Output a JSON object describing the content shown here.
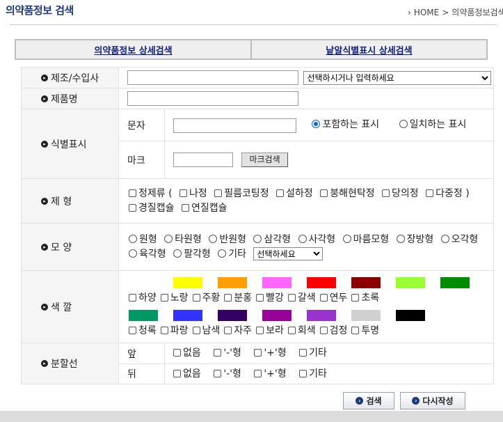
{
  "header": {
    "title": "의약품정보 검색",
    "breadcrumb": [
      "HOME",
      "의약품정보검색"
    ],
    "separator": ">"
  },
  "tabs": [
    {
      "label": "의약품정보 상세검색"
    },
    {
      "label": "낱알식별표시 상세검색"
    }
  ],
  "form": {
    "manufacturer": {
      "label": "제조/수입사",
      "input_value": "",
      "select_value": "선택하시거나 입력하세요"
    },
    "product": {
      "label": "제품명",
      "input_value": ""
    },
    "identifier": {
      "label": "식별표시",
      "text_label": "문자",
      "text_value": "",
      "radio_contains": "포함하는 표시",
      "radio_exact": "일치하는 표시",
      "mark_label": "마크",
      "mark_value": "",
      "mark_button": "마크검색"
    },
    "form_type": {
      "label": "제 형",
      "paren_open": "(",
      "paren_close": ")",
      "options": [
        "정제류",
        "나정",
        "필름코팅정",
        "설하정",
        "붕해현탁정",
        "당의정",
        "다중정",
        "경질캡슐",
        "연질캡슐"
      ]
    },
    "shape": {
      "label": "모 양",
      "options": [
        "원형",
        "타원형",
        "반원형",
        "삼각형",
        "사각형",
        "마름모형",
        "장방형",
        "오각형",
        "육각형",
        "팔각형",
        "기타"
      ],
      "select_value": "선택하세요"
    },
    "color": {
      "label": "색 깔",
      "row1": [
        {
          "name": "하양",
          "hex": "#ffffff"
        },
        {
          "name": "노랑",
          "hex": "#ffff00"
        },
        {
          "name": "주황",
          "hex": "#ff9f00"
        },
        {
          "name": "분홍",
          "hex": "#ff66ff"
        },
        {
          "name": "빨강",
          "hex": "#ff0000"
        },
        {
          "name": "갈색",
          "hex": "#8b0000"
        },
        {
          "name": "연두",
          "hex": "#99ff33"
        },
        {
          "name": "초록",
          "hex": "#008c00"
        }
      ],
      "row2": [
        {
          "name": "청록",
          "hex": "#009966"
        },
        {
          "name": "파랑",
          "hex": "#3333ff"
        },
        {
          "name": "남색",
          "hex": "#330066"
        },
        {
          "name": "자주",
          "hex": "#990099"
        },
        {
          "name": "보라",
          "hex": "#9933cc"
        },
        {
          "name": "회색",
          "hex": "#d0d0d0"
        },
        {
          "name": "검정",
          "hex": "#000000"
        },
        {
          "name": "투명",
          "hex": ""
        }
      ]
    },
    "split_line": {
      "label": "분할선",
      "front_label": "앞",
      "back_label": "뒤",
      "options": [
        "없음",
        "'-'형",
        "'+'형",
        "기타"
      ]
    }
  },
  "buttons": {
    "search": "검색",
    "reset": "다시작성"
  }
}
